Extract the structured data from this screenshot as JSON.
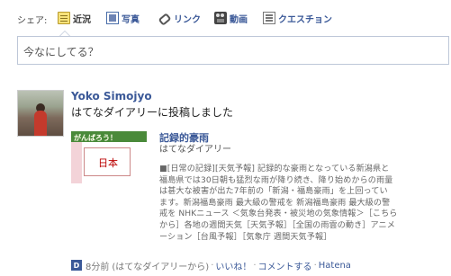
{
  "share": {
    "label": "シェア:",
    "items": [
      {
        "label": "近況",
        "icon": "status-update-icon",
        "active": true
      },
      {
        "label": "写真",
        "icon": "photo-icon"
      },
      {
        "label": "リンク",
        "icon": "link-icon"
      },
      {
        "label": "動画",
        "icon": "video-camera-icon"
      },
      {
        "label": "クエスチョン",
        "icon": "question-icon"
      }
    ]
  },
  "composer": {
    "placeholder": "今なにしてる？"
  },
  "story": {
    "author": "Yoko Simojyo",
    "message": "はてなダイアリーに投稿しました",
    "attachment": {
      "thumb_banner": "がんばろう！",
      "thumb_text": "日本",
      "title": "記録的豪雨",
      "source": "はてなダイアリー",
      "description_lines": [
        "■[日常の記録][天気予報] 記録的な豪雨となっている新潟県と",
        "福島県では30日朝も猛烈な雨が降り続き、降り始めからの雨量",
        "は甚大な被害が出た7年前の「新潟・福島豪雨」を上回ってい",
        "ます。新潟福島豪雨 最大級の警戒を 新潟福島豪雨 最大級の警",
        "戒を NHKニュース ＜気象台発表・被災地の気象情報＞［こちら",
        "から］各地の週間天気［天気予報］［全国の雨雲の動き］アニメ",
        "ーション［台風予報］［気象庁 週間天気予報］"
      ]
    },
    "footer": {
      "app_icon_letter": "D",
      "time": "8分前",
      "via": "(はてなダイアリーから)",
      "like": "いいね！",
      "comment": "コメントする",
      "app": "Hatena"
    }
  },
  "colors": {
    "link": "#3b5998",
    "border": "#bdc7d8"
  }
}
